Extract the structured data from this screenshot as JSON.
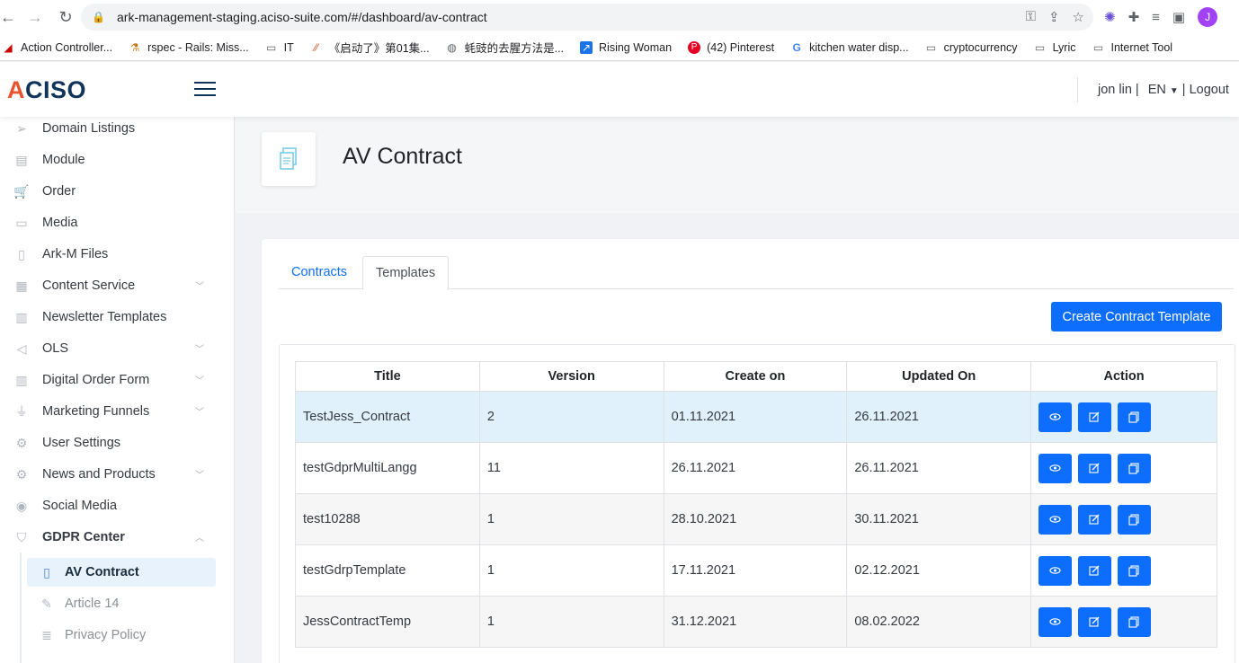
{
  "browser": {
    "url": "ark-management-staging.aciso-suite.com/#/dashboard/av-contract",
    "avatar_letter": "J",
    "bookmarks": [
      {
        "label": "Action Controller...",
        "icon": "rails-icon"
      },
      {
        "label": "rspec - Rails: Miss...",
        "icon": "rspec-icon"
      },
      {
        "label": "IT",
        "icon": "folder-icon"
      },
      {
        "label": "《启动了》第01集...",
        "icon": "video-icon"
      },
      {
        "label": "蚝豉的去腥方法是...",
        "icon": "globe-icon"
      },
      {
        "label": "Rising Woman",
        "icon": "kajabi-icon"
      },
      {
        "label": "(42) Pinterest",
        "icon": "pinterest-icon"
      },
      {
        "label": "kitchen water disp...",
        "icon": "google-icon"
      },
      {
        "label": "cryptocurrency",
        "icon": "folder-icon"
      },
      {
        "label": "Lyric",
        "icon": "folder-icon"
      },
      {
        "label": "Internet Tool",
        "icon": "folder-icon"
      }
    ]
  },
  "header": {
    "logo_first": "A",
    "logo_rest": "CISO",
    "user": "jon lin |",
    "language": "EN",
    "logout": "| Logout"
  },
  "sidebar": {
    "items": [
      {
        "label": "Domain Listings",
        "icon": "send-icon",
        "chevron": false
      },
      {
        "label": "Module",
        "icon": "briefcase-icon",
        "chevron": false
      },
      {
        "label": "Order",
        "icon": "cart-icon",
        "chevron": false
      },
      {
        "label": "Media",
        "icon": "folder-icon",
        "chevron": false
      },
      {
        "label": "Ark-M Files",
        "icon": "file-icon",
        "chevron": false
      },
      {
        "label": "Content Service",
        "icon": "content-icon",
        "chevron": true
      },
      {
        "label": "Newsletter Templates",
        "icon": "newsletter-icon",
        "chevron": false
      },
      {
        "label": "OLS",
        "icon": "megaphone-icon",
        "chevron": true
      },
      {
        "label": "Digital Order Form",
        "icon": "form-icon",
        "chevron": true
      },
      {
        "label": "Marketing Funnels",
        "icon": "funnel-icon",
        "chevron": true
      },
      {
        "label": "User Settings",
        "icon": "gear-icon",
        "chevron": false
      },
      {
        "label": "News and Products",
        "icon": "gear-icon",
        "chevron": true
      },
      {
        "label": "Social Media",
        "icon": "social-icon",
        "chevron": false
      },
      {
        "label": "GDPR Center",
        "icon": "shield-icon",
        "chevron": true
      }
    ],
    "sub_items": [
      {
        "label": "AV Contract",
        "icon": "document-icon",
        "active": true
      },
      {
        "label": "Article 14",
        "icon": "edit-icon",
        "active": false
      },
      {
        "label": "Privacy Policy",
        "icon": "list-icon",
        "active": false
      }
    ]
  },
  "page": {
    "title": "AV Contract",
    "tabs": [
      {
        "label": "Contracts",
        "active": false
      },
      {
        "label": "Templates",
        "active": true
      }
    ],
    "create_button": "Create Contract Template",
    "table": {
      "headers": [
        "Title",
        "Version",
        "Create on",
        "Updated On",
        "Action"
      ],
      "rows": [
        {
          "title": "TestJess_Contract",
          "version": "2",
          "created": "01.11.2021",
          "updated": "26.11.2021"
        },
        {
          "title": "testGdprMultiLangg",
          "version": "11",
          "created": "26.11.2021",
          "updated": "26.11.2021"
        },
        {
          "title": "test10288",
          "version": "1",
          "created": "28.10.2021",
          "updated": "30.11.2021"
        },
        {
          "title": "testGdrpTemplate",
          "version": "1",
          "created": "17.11.2021",
          "updated": "02.12.2021"
        },
        {
          "title": "JessContractTemp",
          "version": "1",
          "created": "31.12.2021",
          "updated": "08.02.2022"
        }
      ]
    }
  },
  "colors": {
    "primary": "#0d6efd",
    "highlight_row": "#e0f1fb",
    "logo_accent": "#e8542f",
    "logo_dark": "#11345a"
  }
}
